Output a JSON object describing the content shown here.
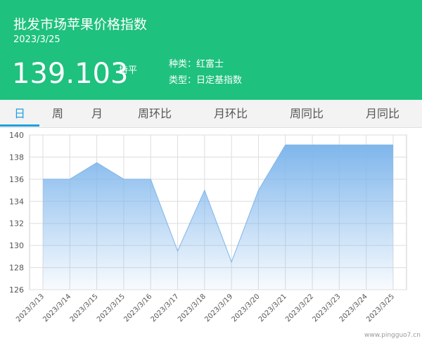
{
  "header": {
    "title": "批发市场苹果价格指数",
    "date": "2023/3/25",
    "value": "139.103",
    "trend": "持平",
    "variety": "种类：红富士",
    "index_type": "类型：日定基指数"
  },
  "tabs": [
    {
      "label": "日",
      "active": true
    },
    {
      "label": "周",
      "active": false
    },
    {
      "label": "月",
      "active": false
    },
    {
      "label": "周环比",
      "active": false
    },
    {
      "label": "月环比",
      "active": false
    },
    {
      "label": "周同比",
      "active": false
    },
    {
      "label": "月同比",
      "active": false
    }
  ],
  "colors": {
    "header_bg": "#1ec17d",
    "accent": "#1ea0e0",
    "line": "#7fb6e8"
  },
  "watermark": "www.pingguo7.cn",
  "chart_data": {
    "type": "area",
    "x": [
      "2023/3/13",
      "2023/3/14",
      "2023/3/15",
      "2023/3/15",
      "2023/3/16",
      "2023/3/17",
      "2023/3/18",
      "2023/3/19",
      "2023/3/20",
      "2023/3/21",
      "2023/3/22",
      "2023/3/23",
      "2023/3/24",
      "2023/3/25"
    ],
    "values": [
      136.0,
      136.0,
      137.5,
      136.0,
      136.0,
      129.5,
      135.0,
      128.5,
      135.0,
      139.1,
      139.1,
      139.1,
      139.1,
      139.103
    ],
    "ylim": [
      126,
      140
    ],
    "yticks": [
      126,
      128,
      130,
      132,
      134,
      136,
      138,
      140
    ],
    "grid": true,
    "title": "",
    "xlabel": "",
    "ylabel": ""
  }
}
